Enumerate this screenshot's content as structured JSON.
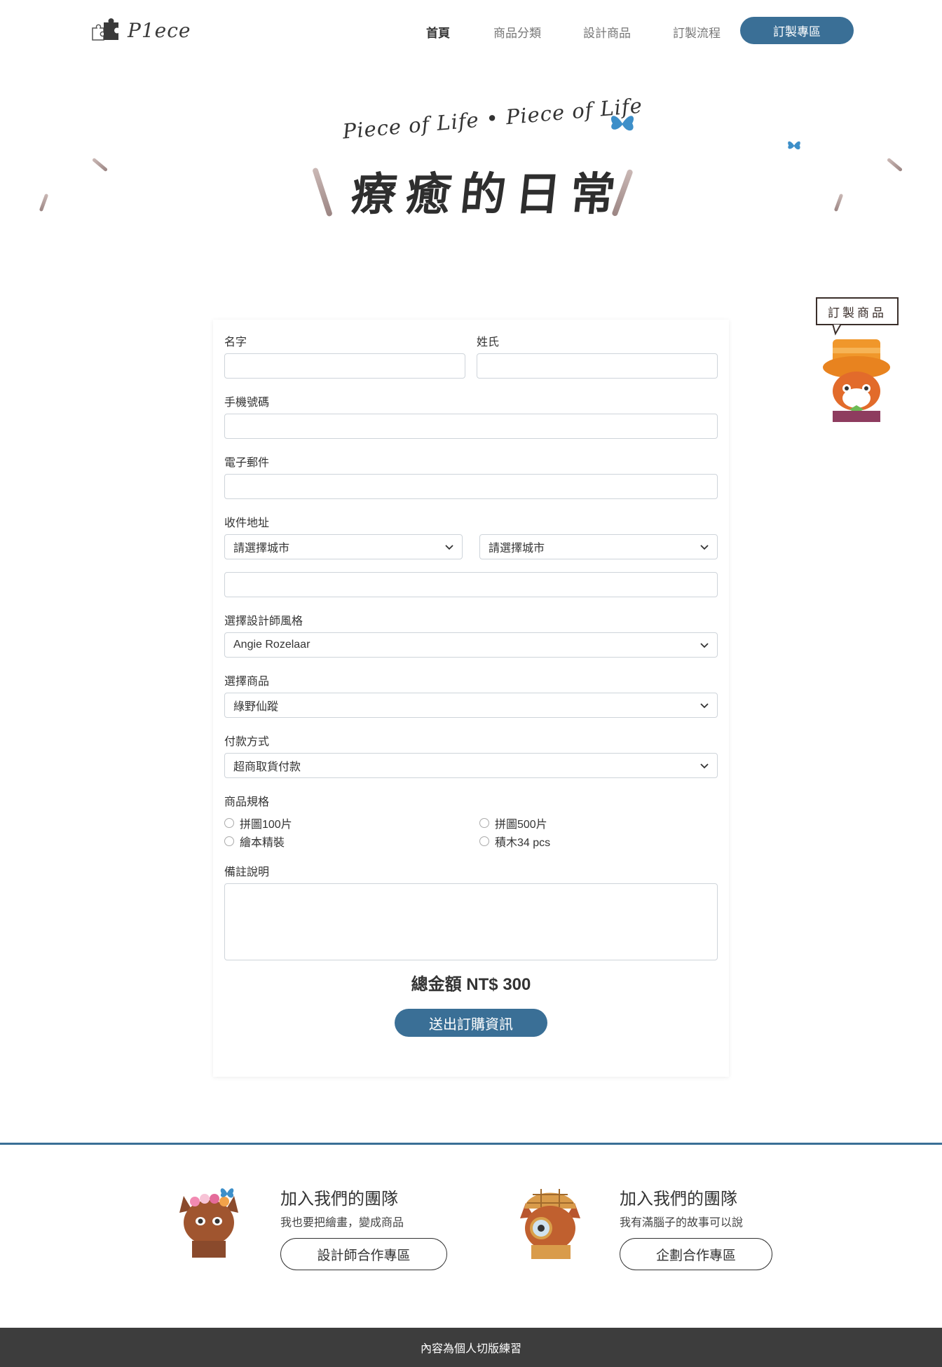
{
  "nav": {
    "logo_text": "P1ece",
    "links": [
      "首頁",
      "商品分類",
      "設計商品",
      "訂製流程"
    ],
    "cta": "訂製專區",
    "brand_color": "#3a6f96"
  },
  "hero": {
    "subtitle": "Piece of Life  •  Piece of Life",
    "title": "療癒的日常"
  },
  "float": {
    "label": "訂製商品"
  },
  "form": {
    "first_name_label": "名字",
    "last_name_label": "姓氏",
    "phone_label": "手機號碼",
    "email_label": "電子郵件",
    "address_label": "收件地址",
    "city_select_1": "請選擇城市",
    "city_select_2": "請選擇城市",
    "designer_label": "選擇設計師風格",
    "designer_value": "Angie Rozelaar",
    "product_label": "選擇商品",
    "product_value": "綠野仙蹤",
    "payment_label": "付款方式",
    "payment_value": "超商取貨付款",
    "spec_label": "商品規格",
    "spec_options": [
      "拼圖100片",
      "拼圖500片",
      "繪本精裝",
      "積木34 pcs"
    ],
    "note_label": "備註說明",
    "total": "總金額 NT$ 300",
    "submit": "送出訂購資訊"
  },
  "join": [
    {
      "title": "加入我們的團隊",
      "desc": "我也要把繪畫，變成商品",
      "button": "設計師合作專區"
    },
    {
      "title": "加入我們的團隊",
      "desc": "我有滿腦子的故事可以說",
      "button": "企劃合作專區"
    }
  ],
  "footer": {
    "copyright": "內容為個人切版練習"
  }
}
